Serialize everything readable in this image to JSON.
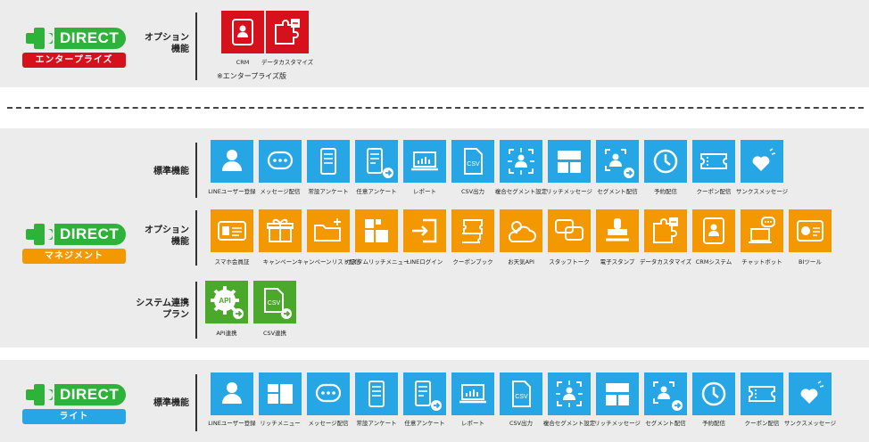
{
  "brand": {
    "word": "DIRECT",
    "green": "#2fb23a"
  },
  "colors": {
    "red": "#d7111b",
    "blue": "#27a6e5",
    "orange": "#f39800",
    "green": "#4aa82a",
    "panel": "#ececec"
  },
  "enterprise": {
    "badge": "エンタープライズ",
    "label_line1": "オプション",
    "label_line2": "機能",
    "items": [
      {
        "label": "CRM",
        "icon": "contact-card-icon"
      },
      {
        "label": "データカスタマイズ",
        "icon": "puzzle-icon"
      }
    ],
    "note": "※エンタープライズ版"
  },
  "manager": {
    "badge": "マネジメント",
    "standard_label": "標準機能",
    "standard_items": [
      {
        "label": "LINEユーザー登録",
        "icon": "user-icon"
      },
      {
        "label": "メッセージ配信",
        "icon": "chat-bubble-icon"
      },
      {
        "label": "常設アンケート",
        "icon": "phone-checklist-icon"
      },
      {
        "label": "任意アンケート",
        "icon": "phone-checklist-arrow-icon"
      },
      {
        "label": "レポート",
        "icon": "laptop-chart-icon"
      },
      {
        "label": "CSV出力",
        "icon": "csv-file-icon"
      },
      {
        "label": "複合セグメント設定",
        "icon": "segment-target-icon"
      },
      {
        "label": "リッチメッセージ",
        "icon": "rich-layout-icon"
      },
      {
        "label": "セグメント配信",
        "icon": "segment-arrow-icon"
      },
      {
        "label": "予約配信",
        "icon": "clock-icon"
      },
      {
        "label": "クーポン配信",
        "icon": "ticket-icon"
      },
      {
        "label": "サンクスメッセージ",
        "icon": "heart-icon"
      }
    ],
    "option_label_line1": "オプション",
    "option_label_line2": "機能",
    "option_items": [
      {
        "label": "スマホ会員証",
        "icon": "member-card-icon"
      },
      {
        "label": "キャンペーン",
        "icon": "gift-icon"
      },
      {
        "label": "キャンペーンリスト配信",
        "icon": "folder-plus-icon"
      },
      {
        "label": "カスタムリッチメニュー",
        "icon": "custom-blocks-icon"
      },
      {
        "label": "LINEログイン",
        "icon": "login-icon"
      },
      {
        "label": "クーポンブック",
        "icon": "coupon-book-icon"
      },
      {
        "label": "お天気API",
        "icon": "weather-icon"
      },
      {
        "label": "スタッフトーク",
        "icon": "talk-bubbles-icon"
      },
      {
        "label": "電子スタンプ",
        "icon": "stamp-icon"
      },
      {
        "label": "データカスタマイズ",
        "icon": "puzzle-icon"
      },
      {
        "label": "CRMシステム",
        "icon": "contact-card-icon"
      },
      {
        "label": "チャットボット",
        "icon": "chatbot-icon"
      },
      {
        "label": "BIツール",
        "icon": "bi-tool-icon"
      }
    ],
    "system_label_line1": "システム連携",
    "system_label_line2": "プラン",
    "system_items": [
      {
        "label": "API連携",
        "icon": "api-gear-icon",
        "icon_text": "API"
      },
      {
        "label": "CSV連携",
        "icon": "csv-link-icon",
        "icon_text": "CSV"
      }
    ]
  },
  "lite": {
    "badge": "ライト",
    "standard_label": "標準機能",
    "items": [
      {
        "label": "LINEユーザー登録",
        "icon": "user-icon"
      },
      {
        "label": "リッチメニュー",
        "icon": "rich-menu-icon"
      },
      {
        "label": "メッセージ配信",
        "icon": "chat-bubble-icon"
      },
      {
        "label": "常設アンケート",
        "icon": "phone-checklist-icon"
      },
      {
        "label": "任意アンケート",
        "icon": "phone-checklist-arrow-icon"
      },
      {
        "label": "レポート",
        "icon": "laptop-chart-icon"
      },
      {
        "label": "CSV出力",
        "icon": "csv-file-icon"
      },
      {
        "label": "複合セグメント設定",
        "icon": "segment-target-icon"
      },
      {
        "label": "リッチメッセージ",
        "icon": "rich-layout-icon"
      },
      {
        "label": "セグメント配信",
        "icon": "segment-arrow-icon"
      },
      {
        "label": "予約配信",
        "icon": "clock-icon"
      },
      {
        "label": "クーポン配信",
        "icon": "ticket-icon"
      },
      {
        "label": "サンクスメッセージ",
        "icon": "heart-icon"
      }
    ]
  }
}
